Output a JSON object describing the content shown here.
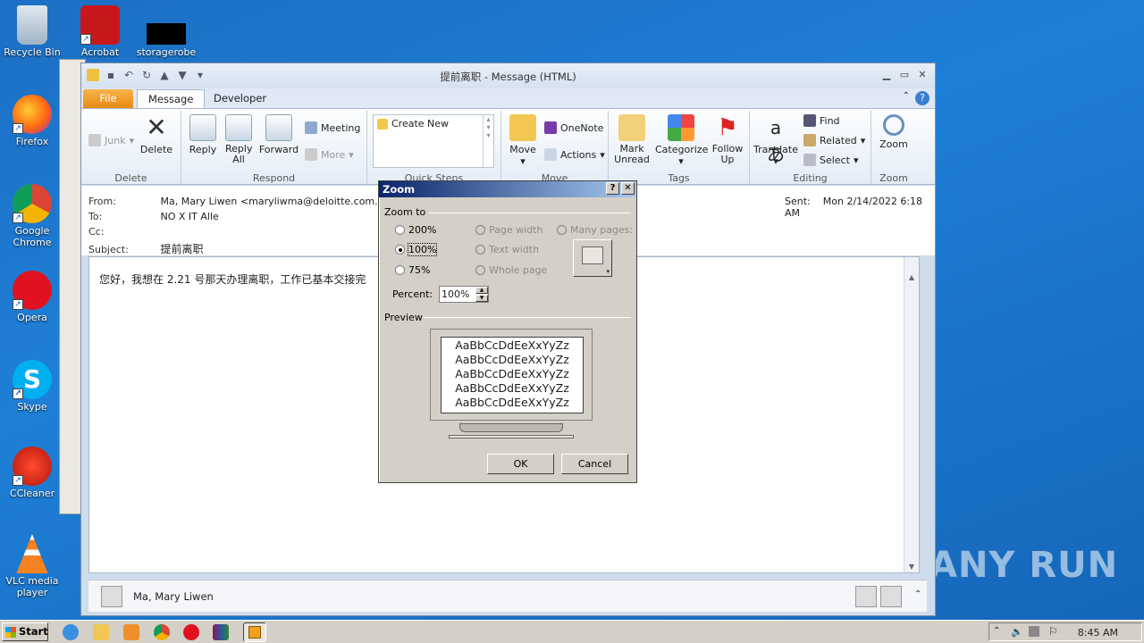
{
  "desktop": {
    "icons": [
      {
        "label": "Recycle Bin"
      },
      {
        "label": "Acrobat"
      },
      {
        "label": "storagerobe"
      },
      {
        "label": "Firefox"
      },
      {
        "label": "Google Chrome"
      },
      {
        "label": "Opera"
      },
      {
        "label": "Skype"
      },
      {
        "label": "CCleaner"
      },
      {
        "label": "VLC media player"
      }
    ],
    "watermark": "ANY RUN"
  },
  "window": {
    "title": "提前离职 - Message (HTML)",
    "tabs": [
      "File",
      "Message",
      "Developer"
    ]
  },
  "ribbon": {
    "delete": {
      "junk": "Junk",
      "delete": "Delete",
      "label": "Delete"
    },
    "respond": {
      "reply": "Reply",
      "reply_all": "Reply All",
      "forward": "Forward",
      "meeting": "Meeting",
      "more": "More",
      "label": "Respond"
    },
    "quick_steps": {
      "create_new": "Create New",
      "label": "Quick Steps"
    },
    "move": {
      "move": "Move",
      "onenote": "OneNote",
      "actions": "Actions",
      "label": "Move"
    },
    "tags": {
      "mark_unread": "Mark Unread",
      "categorize": "Categorize",
      "follow_up": "Follow Up",
      "label": "Tags"
    },
    "editing": {
      "translate": "Translate",
      "find": "Find",
      "related": "Related",
      "select": "Select",
      "label": "Editing"
    },
    "zoom": {
      "zoom": "Zoom",
      "label": "Zoom"
    }
  },
  "message": {
    "from_label": "From:",
    "from": "Ma, Mary Liwen <maryliwma@deloitte.com.cn>",
    "to_label": "To:",
    "to": "NO X IT Alle",
    "cc_label": "Cc:",
    "cc": "",
    "subject_label": "Subject:",
    "subject": "提前离职",
    "sent_label": "Sent:",
    "sent": "Mon 2/14/2022 6:18 AM",
    "body": "您好，我想在 2.21 号那天办理离职，工作已基本交接完"
  },
  "people_pane": {
    "name": "Ma, Mary Liwen"
  },
  "zoom_dialog": {
    "title": "Zoom",
    "zoom_to_label": "Zoom to",
    "options": {
      "p200": "200%",
      "p100": "100%",
      "p75": "75%",
      "page_width": "Page width",
      "text_width": "Text width",
      "whole_page": "Whole page",
      "many_pages": "Many pages:"
    },
    "selected": "100%",
    "percent_label": "Percent:",
    "percent_value": "100%",
    "preview_label": "Preview",
    "preview_lines": [
      "AaBbCcDdEeXxYyZz",
      "AaBbCcDdEeXxYyZz",
      "AaBbCcDdEeXxYyZz",
      "AaBbCcDdEeXxYyZz",
      "AaBbCcDdEeXxYyZz"
    ],
    "ok": "OK",
    "cancel": "Cancel"
  },
  "taskbar": {
    "start": "Start",
    "clock": "8:45 AM"
  },
  "colors": {
    "desktop": "#1e7fd6",
    "file_tab": "#e88a12",
    "dialog_title": "#0a246a"
  }
}
